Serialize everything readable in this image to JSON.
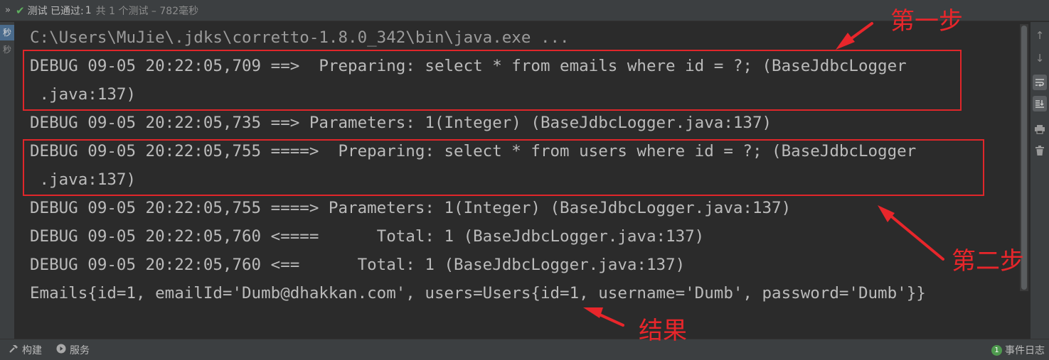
{
  "top_bar": {
    "expand_icon": "chevron-double-right-icon",
    "pass_icon": "check-icon",
    "status": "测试 已通过:",
    "count": "1",
    "count_rest": "共 1 个测试 – 782毫秒"
  },
  "left_strip": {
    "tag_top": "秒",
    "tag_bottom": "秒"
  },
  "console": {
    "lines": [
      "C:\\Users\\MuJie\\.jdks\\corretto-1.8.0_342\\bin\\java.exe ...",
      "DEBUG 09-05 20:22:05,709 ==>  Preparing: select * from emails where id = ?; (BaseJdbcLogger",
      " .java:137)",
      "DEBUG 09-05 20:22:05,735 ==> Parameters: 1(Integer) (BaseJdbcLogger.java:137)",
      "DEBUG 09-05 20:22:05,755 ====>  Preparing: select * from users where id = ?; (BaseJdbcLogger",
      " .java:137)",
      "DEBUG 09-05 20:22:05,755 ====> Parameters: 1(Integer) (BaseJdbcLogger.java:137)",
      "DEBUG 09-05 20:22:05,760 <====      Total: 1 (BaseJdbcLogger.java:137)",
      "DEBUG 09-05 20:22:05,760 <==      Total: 1 (BaseJdbcLogger.java:137)",
      "Emails{id=1, emailId='Dumb@dhakkan.com', users=Users{id=1, username='Dumb', password='Dumb'}}"
    ]
  },
  "right_tools": [
    "arrow-up-icon",
    "arrow-down-icon",
    "soft-wrap-icon",
    "scroll-to-end-icon",
    "print-icon",
    "trash-icon"
  ],
  "bottom_bar": {
    "build_icon": "hammer-icon",
    "build_label": "构建",
    "services_icon": "play-circle-icon",
    "services_label": "服务",
    "event_badge": "1",
    "event_log_label": "事件日志"
  },
  "annotations": {
    "step1": "第一步",
    "step2": "第二步",
    "result": "结果",
    "color": "#e8262b"
  }
}
